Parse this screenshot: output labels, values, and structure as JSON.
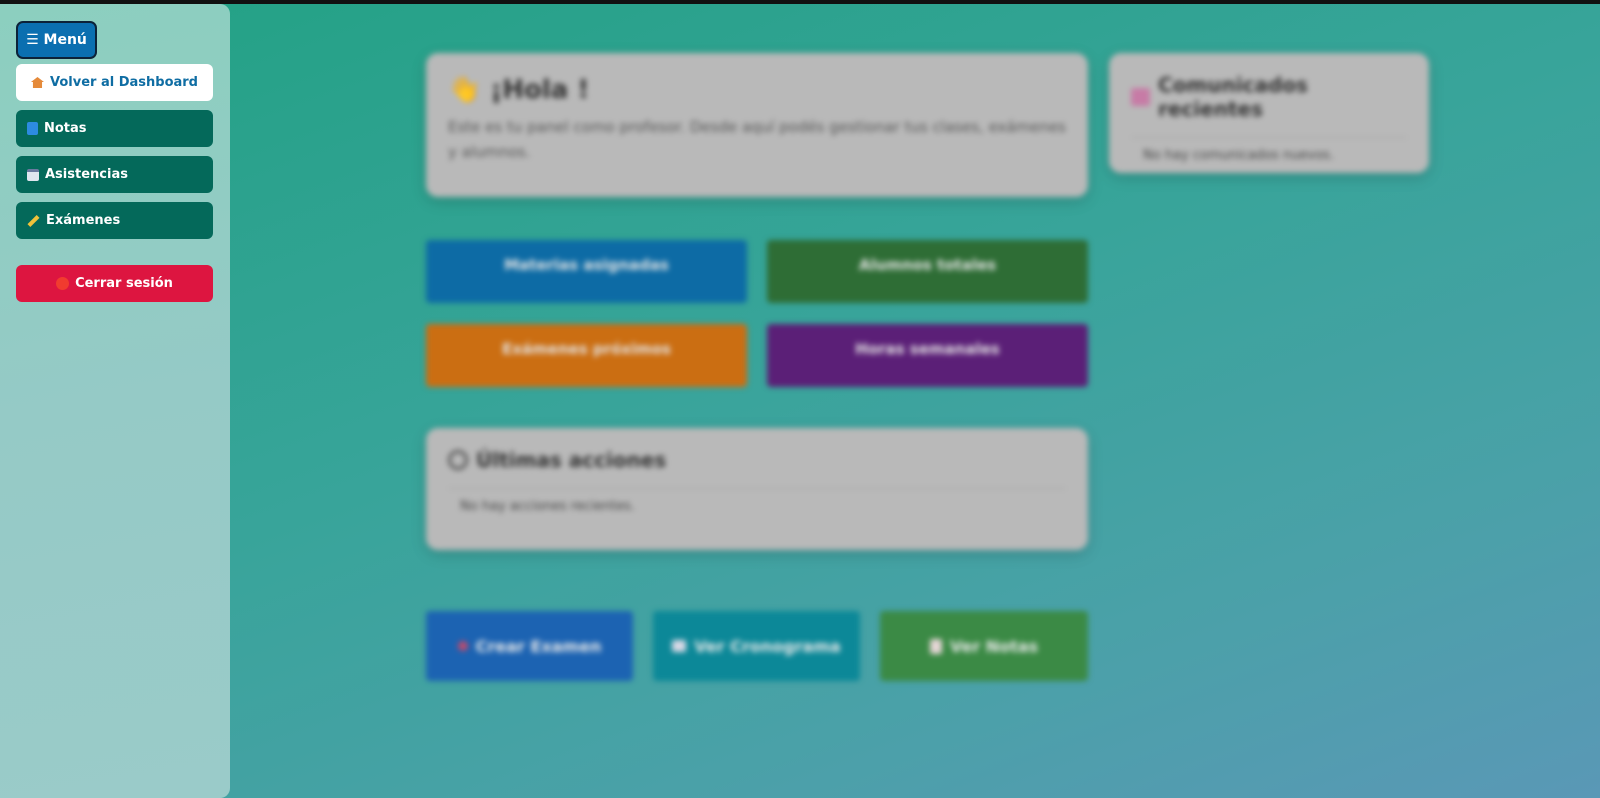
{
  "sidebar": {
    "menu_label": "☰ Menú",
    "items": [
      {
        "label": "Volver al Dashboard",
        "icon": "house-icon"
      },
      {
        "label": "Notas",
        "icon": "book-icon"
      },
      {
        "label": "Asistencias",
        "icon": "calendar-icon"
      },
      {
        "label": "Exámenes",
        "icon": "pencil-icon"
      }
    ],
    "logout_label": "Cerrar sesión",
    "logout_icon": "red-circle-icon"
  },
  "greeting": {
    "title": "¡Hola !",
    "icon": "👋",
    "text": "Este es tu panel como profesor. Desde aquí podés gestionar tus clases, exámenes y alumnos."
  },
  "announcements": {
    "title": "Comunicados recientes",
    "icon": "inbox-icon",
    "empty": "No hay comunicados nuevos."
  },
  "stats": [
    {
      "label": "Materias asignadas",
      "color": "#0d6ba5"
    },
    {
      "label": "Alumnos totales",
      "color": "#2e6d35"
    },
    {
      "label": "Exámenes próximos",
      "color": "#cb6e12"
    },
    {
      "label": "Horas semanales",
      "color": "#5b1f77"
    }
  ],
  "recent_actions": {
    "title": "Últimas acciones",
    "icon": "clock-icon",
    "empty": "No hay acciones recientes."
  },
  "quick_actions": [
    {
      "label": "Crear Examen",
      "icon": "plus-icon"
    },
    {
      "label": "Ver Cronograma",
      "icon": "calendar-icon"
    },
    {
      "label": "Ver Notas",
      "icon": "notes-icon"
    }
  ]
}
